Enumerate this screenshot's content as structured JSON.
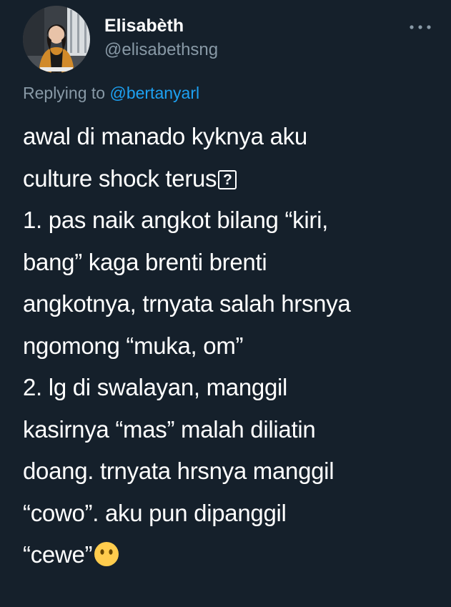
{
  "author": {
    "display_name": "Elisabèth",
    "handle": "@elisabethsng"
  },
  "reply": {
    "prefix": "Replying to",
    "target": "@bertanyarl"
  },
  "tweet": {
    "lines": [
      "awal di manado kyknya aku",
      "culture shock terus",
      "1. pas naik angkot bilang “kiri,",
      "bang” kaga brenti brenti",
      "angkotnya, trnyata salah hrsnya",
      "ngomong “muka, om”",
      "2. lg di swalayan, manggil",
      "kasirnya “mas” malah diliatin",
      "doang. trnyata hrsnya manggil",
      "“cowo”. aku pun dipanggil",
      "“cewe”"
    ],
    "inline_question_glyph": "?",
    "trailing_emoji": "face-without-mouth-emoji"
  },
  "icons": {
    "more": "more-dots-icon"
  },
  "colors": {
    "background": "#15202b",
    "primary_text": "#ffffff",
    "secondary_text": "#8899a6",
    "link": "#1da1f2",
    "emoji": "#ffcc4d"
  }
}
